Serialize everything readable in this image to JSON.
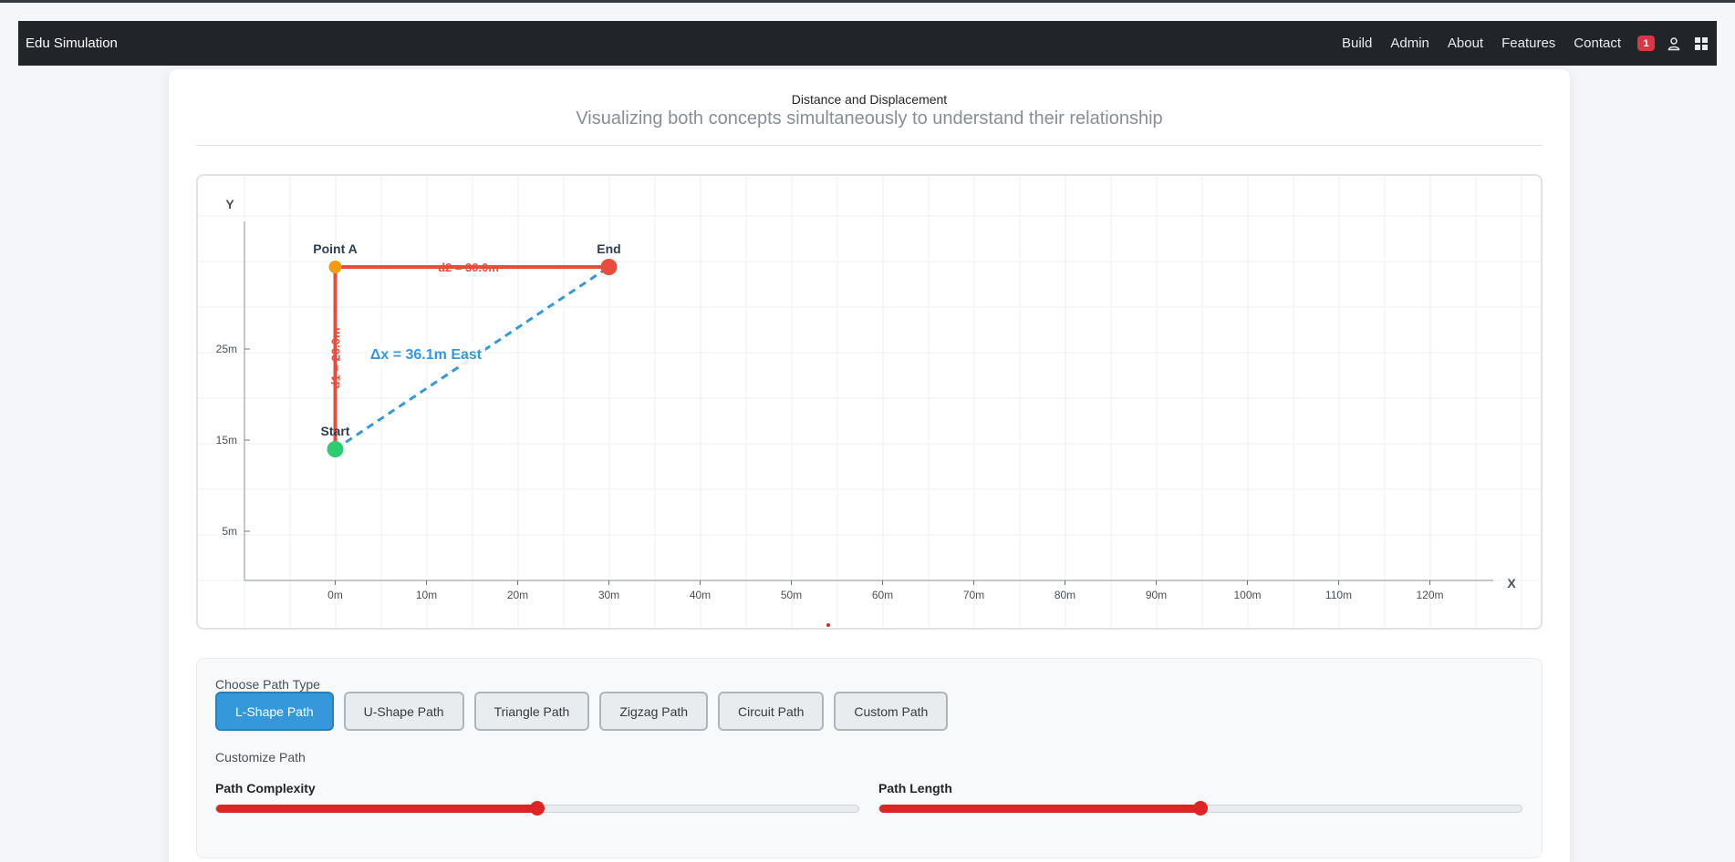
{
  "nav": {
    "brand": "Edu Simulation",
    "links": [
      "Build",
      "Admin",
      "About",
      "Features",
      "Contact"
    ],
    "notification_count": "1",
    "icons": [
      "user-icon",
      "grid-icon"
    ]
  },
  "header": {
    "title": "Distance and Displacement",
    "subtitle": "Visualizing both concepts simultaneously to understand their relationship"
  },
  "plot": {
    "x_axis_letter": "X",
    "y_axis_letter": "Y",
    "x_ticks": [
      0,
      10,
      20,
      30,
      40,
      50,
      60,
      70,
      80,
      90,
      100,
      110,
      120
    ],
    "x_tick_suffix": "m",
    "y_ticks": [
      5,
      15,
      25
    ],
    "y_tick_suffix": "m",
    "points": [
      {
        "id": "start",
        "label": "Start",
        "x": 0,
        "y": 14,
        "color": "#2ecc71"
      },
      {
        "id": "point-a",
        "label": "Point A",
        "x": 0,
        "y": 34,
        "color": "#f39c12"
      },
      {
        "id": "end",
        "label": "End",
        "x": 30,
        "y": 34,
        "color": "#e74c3c"
      }
    ],
    "segments": [
      {
        "from": "start",
        "to": "point-a",
        "label": "d1 = 20.0m"
      },
      {
        "from": "point-a",
        "to": "end",
        "label": "d2 = 30.0m"
      }
    ],
    "displacement": {
      "label": "Δx = 36.1m East",
      "from": "start",
      "to": "end"
    },
    "path_color": "#e74c3c",
    "displacement_color": "#3498db"
  },
  "controls": {
    "path_type_label": "Choose Path Type",
    "path_buttons": [
      "L-Shape Path",
      "U-Shape Path",
      "Triangle Path",
      "Zigzag Path",
      "Circuit Path",
      "Custom Path"
    ],
    "active_path": "L-Shape Path",
    "customize_label": "Customize Path",
    "complexity": {
      "label": "Path Complexity",
      "value_fraction": 0.5
    },
    "length": {
      "label": "Path Length",
      "value_fraction": 0.5
    },
    "accent_color": "#dc2626"
  }
}
